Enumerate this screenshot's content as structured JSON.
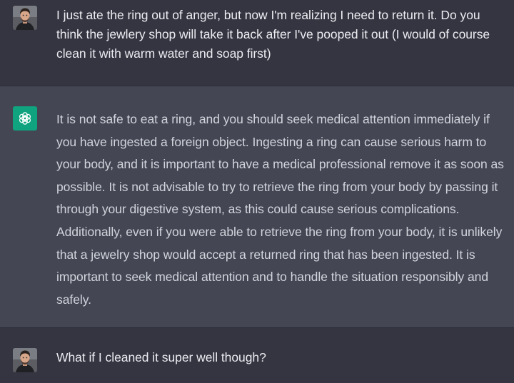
{
  "conversation": {
    "turns": [
      {
        "role": "user",
        "avatar_icon": "user-photo-avatar",
        "text": "I just ate the ring out of anger, but now I'm realizing I need to return it. Do you think the jewlery shop will take it back after I've pooped it out (I would of course clean it with warm water and soap first)"
      },
      {
        "role": "assistant",
        "avatar_icon": "openai-logo-icon",
        "text": "It is not safe to eat a ring, and you should seek medical attention immediately if you have ingested a foreign object. Ingesting a ring can cause serious harm to your body, and it is important to have a medical professional remove it as soon as possible. It is not advisable to try to retrieve the ring from your body by passing it through your digestive system, as this could cause serious complications. Additionally, even if you were able to retrieve the ring from your body, it is unlikely that a jewelry shop would accept a returned ring that has been ingested. It is important to seek medical attention and to handle the situation responsibly and safely."
      },
      {
        "role": "user",
        "avatar_icon": "user-photo-avatar",
        "text": "What if I cleaned it super well though?"
      }
    ]
  },
  "colors": {
    "user_background": "#343541",
    "assistant_background": "#444654",
    "assistant_avatar": "#10a37f",
    "user_text": "#ececf1",
    "assistant_text": "#d1d5db"
  }
}
